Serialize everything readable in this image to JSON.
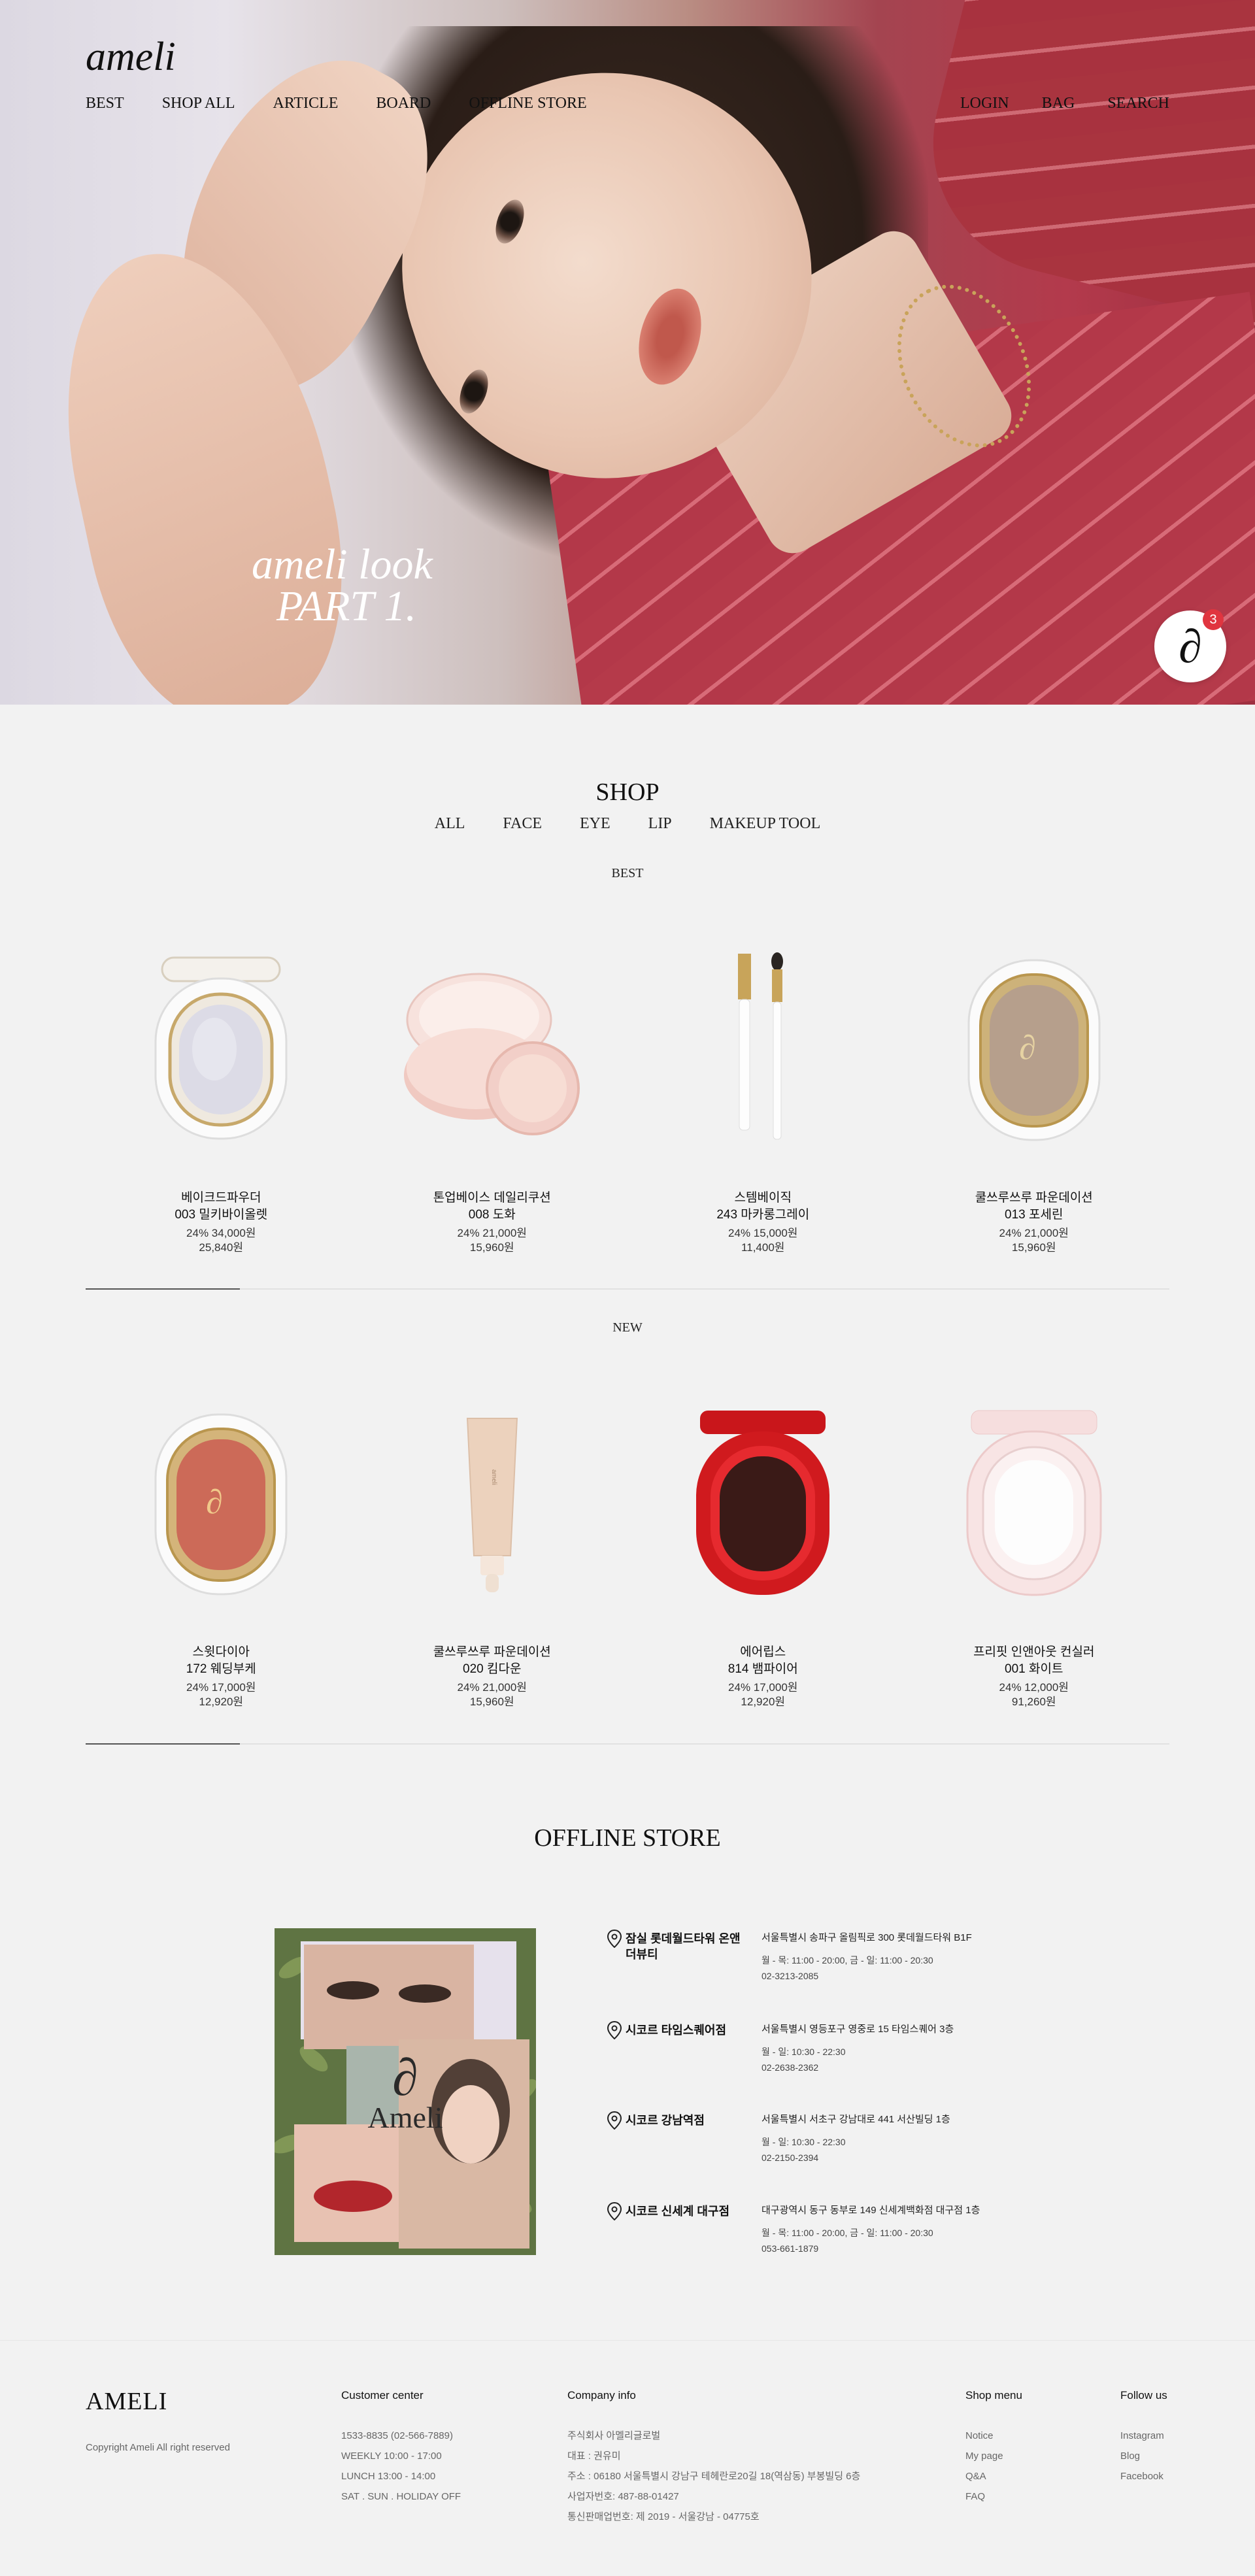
{
  "brand": {
    "logo": "ameli"
  },
  "nav": {
    "left": [
      "BEST",
      "SHOP ALL",
      "ARTICLE",
      "BOARD",
      "OFFLINE STORE"
    ],
    "right": [
      "LOGIN",
      "BAG",
      "SEARCH"
    ]
  },
  "hero": {
    "caption_line1": "ameli look",
    "caption_line2": "PART 1."
  },
  "floating_badge": {
    "glyph": "∂",
    "count": "3"
  },
  "shop": {
    "title": "SHOP",
    "tabs": [
      "ALL",
      "FACE",
      "EYE",
      "LIP",
      "MAKEUP TOOL"
    ],
    "best_label": "BEST",
    "new_label": "NEW",
    "best": [
      {
        "name1": "베이크드파우더",
        "name2": "003 밀키바이올렛",
        "price1": "24% 34,000원",
        "price2": "25,840원",
        "color": "#dcdbe6"
      },
      {
        "name1": "톤업베이스 데일리쿠션",
        "name2": "008 도화",
        "price1": "24% 21,000원",
        "price2": "15,960원",
        "color": "#f2d2cc"
      },
      {
        "name1": "스템베이직",
        "name2": "243 마카롱그레이",
        "price1": "24% 15,000원",
        "price2": "11,400원",
        "color": "#c8a45a"
      },
      {
        "name1": "쿨쓰루쓰루 파운데이션",
        "name2": "013 포세린",
        "price1": "24% 21,000원",
        "price2": "15,960원",
        "color": "#b69f8c"
      }
    ],
    "new": [
      {
        "name1": "스윗다이아",
        "name2": "172 웨딩부케",
        "price1": "24% 17,000원",
        "price2": "12,920원",
        "color": "#cc6a58"
      },
      {
        "name1": "쿨쓰루쓰루 파운데이션",
        "name2": "020 킴다운",
        "price1": "24% 21,000원",
        "price2": "15,960원",
        "color": "#ecd2bd"
      },
      {
        "name1": "에어립스",
        "name2": "814 뱀파이어",
        "price1": "24% 17,000원",
        "price2": "12,920원",
        "color": "#d01a1e"
      },
      {
        "name1": "프리핏 인앤아웃 컨실러",
        "name2": "001 화이트",
        "price1": "24% 12,000원",
        "price2": "91,260원",
        "color": "#f4dcdc"
      }
    ]
  },
  "offline": {
    "title": "OFFLINE STORE",
    "image_logo_glyph": "∂",
    "image_logo_text": "Ameli",
    "stores": [
      {
        "name": "잠실 롯데월드타워 온앤더뷰티",
        "address": "서울특별시 송파구 올림픽로 300 롯데월드타워 B1F",
        "hours": "월 - 목: 11:00 - 20:00, 금 - 일: 11:00 - 20:30",
        "tel": "02-3213-2085"
      },
      {
        "name": "시코르 타임스퀘어점",
        "address": "서울특별시 영등포구 영중로 15 타임스퀘어 3층",
        "hours": "월 - 일: 10:30 - 22:30",
        "tel": "02-2638-2362"
      },
      {
        "name": "시코르 강남역점",
        "address": "서울특별시 서초구 강남대로 441 서산빌딩 1층",
        "hours": "월 - 일: 10:30 - 22:30",
        "tel": "02-2150-2394"
      },
      {
        "name": "시코르 신세계 대구점",
        "address": "대구광역시 동구 동부로 149 신세계백화점 대구점 1층",
        "hours": "월 - 목: 11:00 - 20:00, 금 - 일: 11:00 - 20:30",
        "tel": "053-661-1879"
      }
    ]
  },
  "footer": {
    "logo": "AMELI",
    "copyright": "Copyright Ameli All right reserved",
    "customer_center": {
      "title": "Customer center",
      "lines": [
        "1533-8835 (02-566-7889)",
        "WEEKLY 10:00 - 17:00",
        "LUNCH 13:00 - 14:00",
        "SAT . SUN . HOLIDAY OFF"
      ]
    },
    "company_info": {
      "title": "Company info",
      "lines": [
        "주식회사 아멜리글로벌",
        "대표 : 권유미",
        "주소 : 06180 서울특별시 강남구 테헤란로20길 18(역삼동) 부봉빌딩 6층",
        "사업자번호: 487-88-01427",
        "통신판매업번호: 제 2019 - 서울강남 - 04775호"
      ]
    },
    "shop_menu": {
      "title": "Shop menu",
      "links": [
        "Notice",
        "My page",
        "Q&A",
        "FAQ"
      ]
    },
    "follow_us": {
      "title": "Follow us",
      "links": [
        "Instagram",
        "Blog",
        "Facebook"
      ]
    }
  }
}
